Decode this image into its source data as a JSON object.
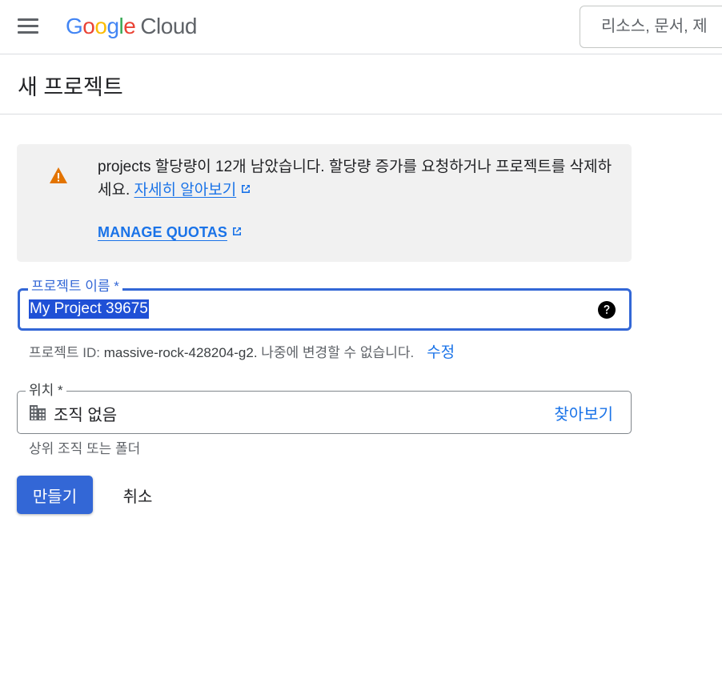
{
  "header": {
    "menu_icon": "hamburger-menu-icon",
    "logo": {
      "google": "Google",
      "product": "Cloud"
    },
    "search": {
      "placeholder": "리소스, 문서, 제"
    }
  },
  "page": {
    "title": "새 프로젝트"
  },
  "alert": {
    "icon": "warning-icon",
    "icon_color": "#e37400",
    "message": "projects 할당량이 12개 남았습니다. 할당량 증가를 요청하거나 프로젝트를 삭제하세요.",
    "learn_more": "자세히 알아보기",
    "manage_quotas": "MANAGE QUOTAS"
  },
  "form": {
    "project_name": {
      "label": "프로젝트 이름 *",
      "value": "My Project 39675",
      "help_icon": "help-circle-icon"
    },
    "project_id": {
      "prefix": "프로젝트 ID: ",
      "id": "massive-rock-428204-g2.",
      "suffix": " 나중에 변경할 수 없습니다.",
      "edit_label": "수정"
    },
    "location": {
      "label": "위치 *",
      "icon": "organization-building-icon",
      "value": "조직 없음",
      "browse_label": "찾아보기",
      "help_text": "상위 조직 또는 폴더"
    }
  },
  "actions": {
    "create_label": "만들기",
    "cancel_label": "취소"
  },
  "colors": {
    "accent": "#3367d6",
    "link": "#1a73e8"
  }
}
